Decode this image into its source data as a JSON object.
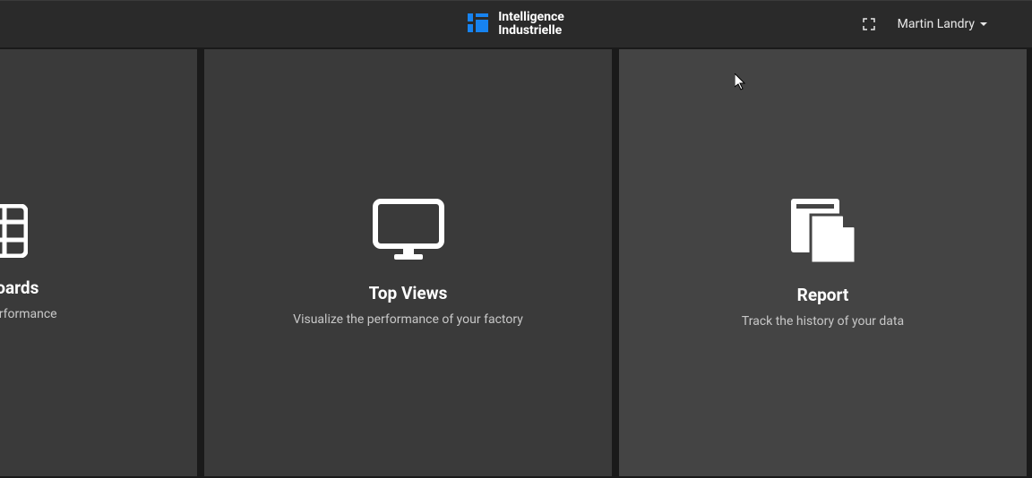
{
  "header": {
    "brand_line1": "Intelligence",
    "brand_line2": "Industrielle",
    "user_name": "Martin Landry"
  },
  "cards": [
    {
      "title": "Dashboards",
      "subtitle": "Real-time performance"
    },
    {
      "title": "Top Views",
      "subtitle": "Visualize the performance of your factory"
    },
    {
      "title": "Report",
      "subtitle": "Track the history of your data"
    }
  ]
}
